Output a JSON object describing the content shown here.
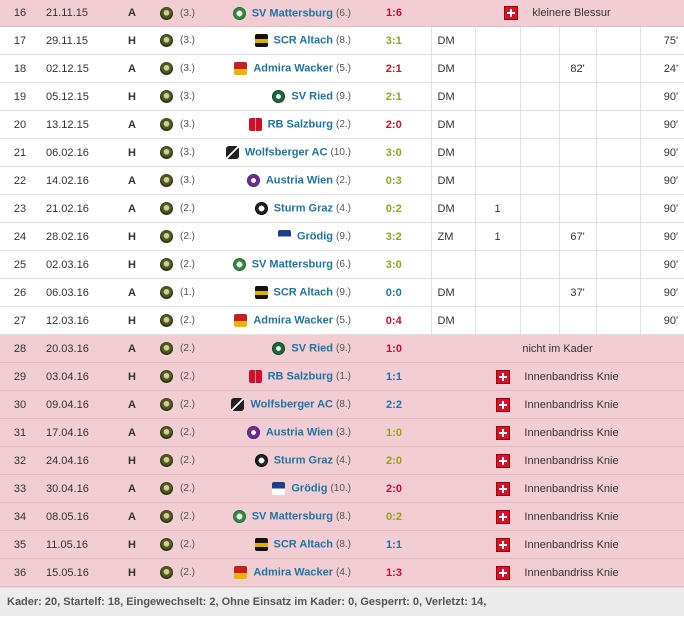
{
  "rows": [
    {
      "nr": "16",
      "date": "21.11.15",
      "ha": "A",
      "own_rank": "(3.)",
      "opp": "SV Mattersburg",
      "opp_crest": "matt",
      "opp_rank": "(6.)",
      "result": "1:6",
      "res": "loss",
      "absent": true,
      "absent_icon": true,
      "absent_text": "kleinere Blessur"
    },
    {
      "nr": "17",
      "date": "29.11.15",
      "ha": "H",
      "own_rank": "(3.)",
      "opp": "SCR Altach",
      "opp_crest": "altach",
      "opp_rank": "(8.)",
      "result": "3:1",
      "res": "win",
      "pos": "DM",
      "goals": "",
      "assists": "",
      "sub_in": "",
      "sub_out": "",
      "minutes": "75'"
    },
    {
      "nr": "18",
      "date": "02.12.15",
      "ha": "A",
      "own_rank": "(3.)",
      "opp": "Admira Wacker",
      "opp_crest": "admira",
      "opp_rank": "(5.)",
      "result": "2:1",
      "res": "loss",
      "pos": "DM",
      "goals": "",
      "assists": "",
      "sub_in": "82'",
      "sub_out": "",
      "minutes": "24'"
    },
    {
      "nr": "19",
      "date": "05.12.15",
      "ha": "H",
      "own_rank": "(3.)",
      "opp": "SV Ried",
      "opp_crest": "ried",
      "opp_rank": "(9.)",
      "result": "2:1",
      "res": "win",
      "pos": "DM",
      "goals": "",
      "assists": "",
      "sub_in": "",
      "sub_out": "",
      "minutes": "90'"
    },
    {
      "nr": "20",
      "date": "13.12.15",
      "ha": "A",
      "own_rank": "(3.)",
      "opp": "RB Salzburg",
      "opp_crest": "rb",
      "opp_rank": "(2.)",
      "result": "2:0",
      "res": "loss",
      "pos": "DM",
      "goals": "",
      "assists": "",
      "sub_in": "",
      "sub_out": "",
      "minutes": "90'"
    },
    {
      "nr": "21",
      "date": "06.02.16",
      "ha": "H",
      "own_rank": "(3.)",
      "opp": "Wolfsberger AC",
      "opp_crest": "wac",
      "opp_rank": "(10.)",
      "result": "3:0",
      "res": "win",
      "pos": "DM",
      "goals": "",
      "assists": "",
      "sub_in": "",
      "sub_out": "",
      "minutes": "90'"
    },
    {
      "nr": "22",
      "date": "14.02.16",
      "ha": "A",
      "own_rank": "(3.)",
      "opp": "Austria Wien",
      "opp_crest": "austria",
      "opp_rank": "(2.)",
      "result": "0:3",
      "res": "win",
      "pos": "DM",
      "goals": "",
      "assists": "",
      "sub_in": "",
      "sub_out": "",
      "minutes": "90'"
    },
    {
      "nr": "23",
      "date": "21.02.16",
      "ha": "A",
      "own_rank": "(2.)",
      "opp": "Sturm Graz",
      "opp_crest": "sturm",
      "opp_rank": "(4.)",
      "result": "0:2",
      "res": "win",
      "pos": "DM",
      "goals": "1",
      "assists": "",
      "sub_in": "",
      "sub_out": "",
      "minutes": "90'"
    },
    {
      "nr": "24",
      "date": "28.02.16",
      "ha": "H",
      "own_rank": "(2.)",
      "opp": "Grödig",
      "opp_crest": "grodig",
      "opp_rank": "(9.)",
      "result": "3:2",
      "res": "win",
      "pos": "ZM",
      "goals": "1",
      "assists": "",
      "sub_in": "67'",
      "sub_out": "",
      "minutes": "90'"
    },
    {
      "nr": "25",
      "date": "02.03.16",
      "ha": "H",
      "own_rank": "(2.)",
      "opp": "SV Mattersburg",
      "opp_crest": "matt",
      "opp_rank": "(6.)",
      "result": "3:0",
      "res": "win",
      "pos": "",
      "goals": "",
      "assists": "",
      "sub_in": "",
      "sub_out": "",
      "minutes": "90'"
    },
    {
      "nr": "26",
      "date": "06.03.16",
      "ha": "A",
      "own_rank": "(1.)",
      "opp": "SCR Altach",
      "opp_crest": "altach",
      "opp_rank": "(9.)",
      "result": "0:0",
      "res": "draw",
      "pos": "DM",
      "goals": "",
      "assists": "",
      "sub_in": "37'",
      "sub_out": "",
      "minutes": "90'"
    },
    {
      "nr": "27",
      "date": "12.03.16",
      "ha": "H",
      "own_rank": "(2.)",
      "opp": "Admira Wacker",
      "opp_crest": "admira",
      "opp_rank": "(5.)",
      "result": "0:4",
      "res": "loss",
      "pos": "DM",
      "goals": "",
      "assists": "",
      "sub_in": "",
      "sub_out": "",
      "minutes": "90'"
    },
    {
      "nr": "28",
      "date": "20.03.16",
      "ha": "A",
      "own_rank": "(2.)",
      "opp": "SV Ried",
      "opp_crest": "ried",
      "opp_rank": "(9.)",
      "result": "1:0",
      "res": "loss",
      "absent": true,
      "absent_icon": false,
      "absent_text": "nicht im Kader"
    },
    {
      "nr": "29",
      "date": "03.04.16",
      "ha": "H",
      "own_rank": "(2.)",
      "opp": "RB Salzburg",
      "opp_crest": "rb",
      "opp_rank": "(1.)",
      "result": "1:1",
      "res": "draw",
      "absent": true,
      "absent_icon": true,
      "absent_text": "Innenbandriss Knie"
    },
    {
      "nr": "30",
      "date": "09.04.16",
      "ha": "A",
      "own_rank": "(2.)",
      "opp": "Wolfsberger AC",
      "opp_crest": "wac",
      "opp_rank": "(8.)",
      "result": "2:2",
      "res": "draw",
      "absent": true,
      "absent_icon": true,
      "absent_text": "Innenbandriss Knie"
    },
    {
      "nr": "31",
      "date": "17.04.16",
      "ha": "A",
      "own_rank": "(2.)",
      "opp": "Austria Wien",
      "opp_crest": "austria",
      "opp_rank": "(3.)",
      "result": "1:0",
      "res": "win",
      "absent": true,
      "absent_icon": true,
      "absent_text": "Innenbandriss Knie"
    },
    {
      "nr": "32",
      "date": "24.04.16",
      "ha": "H",
      "own_rank": "(2.)",
      "opp": "Sturm Graz",
      "opp_crest": "sturm",
      "opp_rank": "(4.)",
      "result": "2:0",
      "res": "win",
      "absent": true,
      "absent_icon": true,
      "absent_text": "Innenbandriss Knie"
    },
    {
      "nr": "33",
      "date": "30.04.16",
      "ha": "A",
      "own_rank": "(2.)",
      "opp": "Grödig",
      "opp_crest": "grodig",
      "opp_rank": "(10.)",
      "result": "2:0",
      "res": "loss",
      "absent": true,
      "absent_icon": true,
      "absent_text": "Innenbandriss Knie"
    },
    {
      "nr": "34",
      "date": "08.05.16",
      "ha": "A",
      "own_rank": "(2.)",
      "opp": "SV Mattersburg",
      "opp_crest": "matt",
      "opp_rank": "(8.)",
      "result": "0:2",
      "res": "win",
      "absent": true,
      "absent_icon": true,
      "absent_text": "Innenbandriss Knie"
    },
    {
      "nr": "35",
      "date": "11.05.16",
      "ha": "H",
      "own_rank": "(2.)",
      "opp": "SCR Altach",
      "opp_crest": "altach",
      "opp_rank": "(8.)",
      "result": "1:1",
      "res": "draw",
      "absent": true,
      "absent_icon": true,
      "absent_text": "Innenbandriss Knie"
    },
    {
      "nr": "36",
      "date": "15.05.16",
      "ha": "H",
      "own_rank": "(2.)",
      "opp": "Admira Wacker",
      "opp_crest": "admira",
      "opp_rank": "(4.)",
      "result": "1:3",
      "res": "loss",
      "absent": true,
      "absent_icon": true,
      "absent_text": "Innenbandriss Knie"
    }
  ],
  "footer": {
    "text": "Kader: 20, Startelf: 18, Eingewechselt: 2, Ohne Einsatz im Kader: 0, Gesperrt: 0, Verletzt: 14,"
  },
  "colors": {
    "absent_row_bg": "#f2cdd3",
    "team_link": "#1d75a3",
    "result_win": "#8ea61a",
    "result_loss": "#c8102e",
    "result_draw": "#1d75a3",
    "injury_icon": "#d0142c"
  },
  "icons": {
    "own_crest": "rapid-crest-icon",
    "injury": "injury-cross-icon"
  }
}
